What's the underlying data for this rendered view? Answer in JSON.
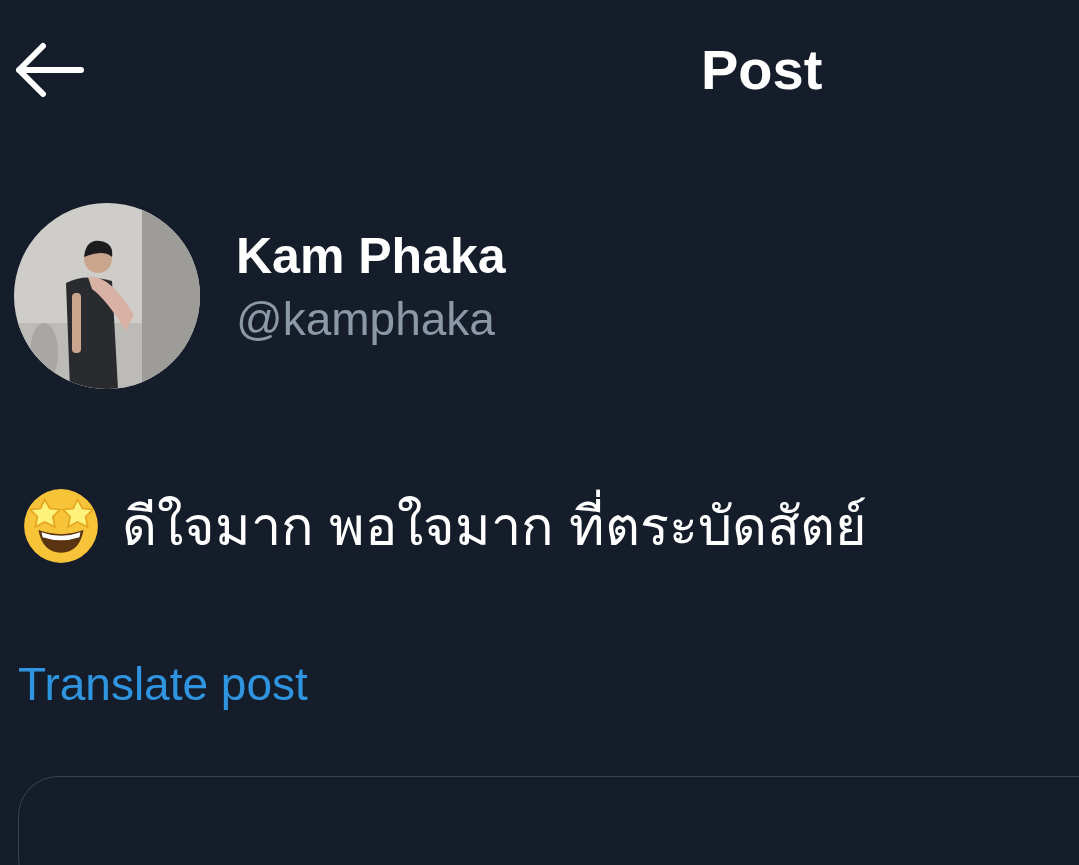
{
  "header": {
    "title": "Post"
  },
  "author": {
    "name": "Kam Phaka",
    "handle": "@kamphaka"
  },
  "post": {
    "text": "ดีใจมาก พอใจมาก ที่ตระบัดสัตย์"
  },
  "translate_link": "Translate post"
}
